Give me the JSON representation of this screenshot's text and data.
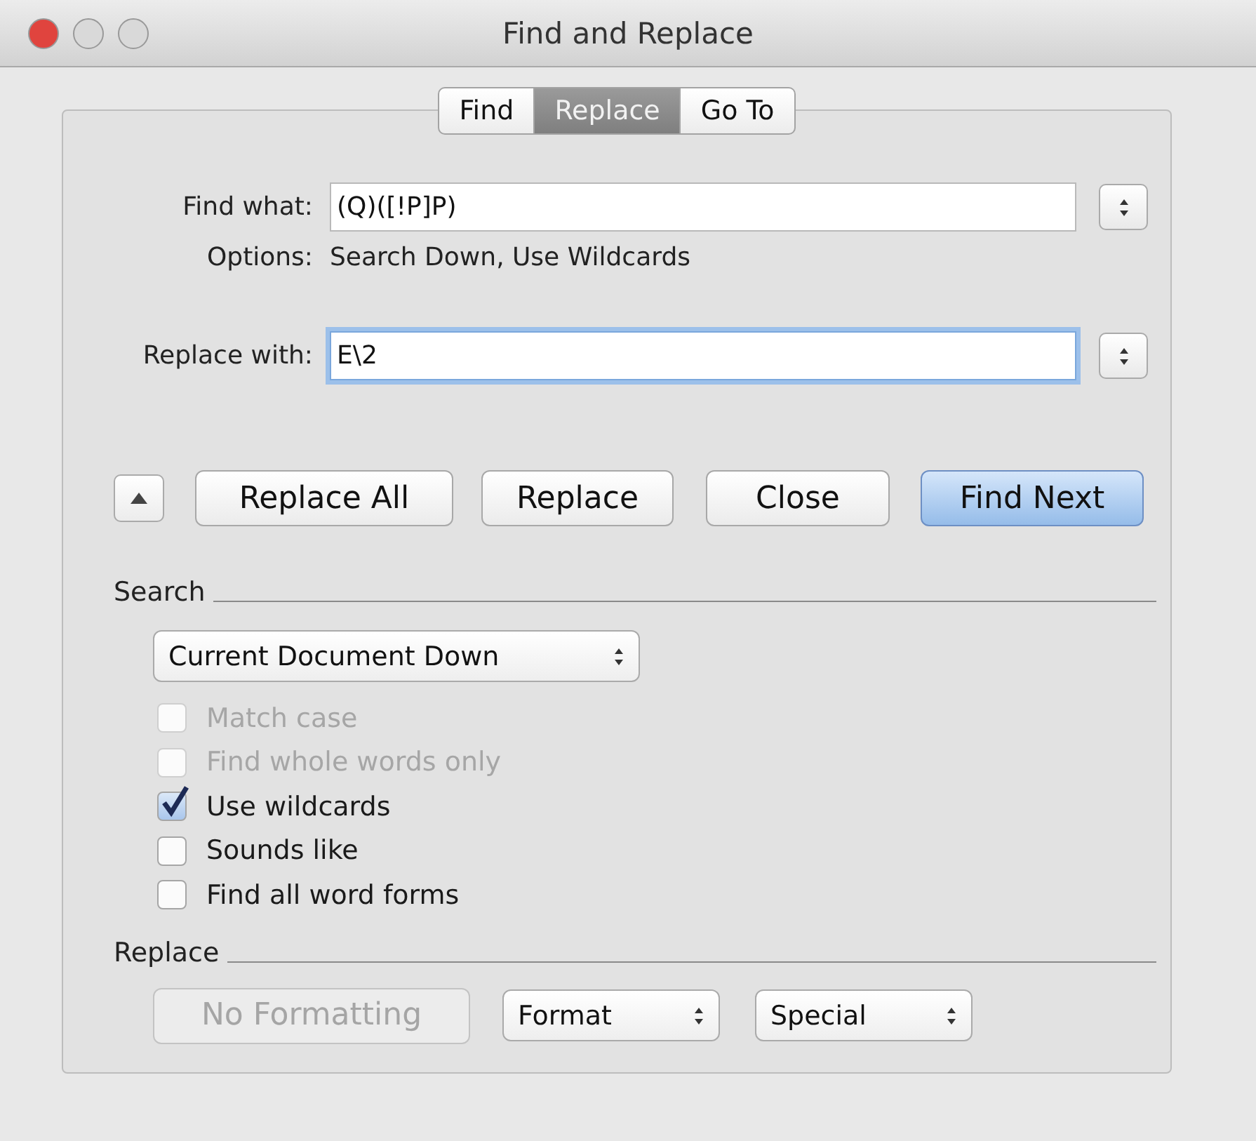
{
  "window": {
    "title": "Find and Replace"
  },
  "tabs": [
    {
      "label": "Find",
      "selected": false
    },
    {
      "label": "Replace",
      "selected": true
    },
    {
      "label": "Go To",
      "selected": false
    }
  ],
  "fields": [
    {
      "label": "Find what:",
      "value": "(Q)([!P]P)",
      "focused": false
    },
    {
      "label": "Replace with:",
      "value": "E\\2",
      "focused": true
    }
  ],
  "options": {
    "label": "Options:",
    "value": "Search Down, Use Wildcards"
  },
  "buttons": [
    {
      "label": "Replace All",
      "default": false
    },
    {
      "label": "Replace",
      "default": false
    },
    {
      "label": "Close",
      "default": false
    },
    {
      "label": "Find Next",
      "default": true
    }
  ],
  "search": {
    "heading": "Search",
    "scope": "Current Document Down",
    "checkboxes": [
      {
        "label": "Match case",
        "checked": false,
        "disabled": true
      },
      {
        "label": "Find whole words only",
        "checked": false,
        "disabled": true
      },
      {
        "label": "Use wildcards",
        "checked": true,
        "disabled": false
      },
      {
        "label": "Sounds like",
        "checked": false,
        "disabled": false
      },
      {
        "label": "Find all word forms",
        "checked": false,
        "disabled": false
      }
    ]
  },
  "replace": {
    "heading": "Replace",
    "no_formatting": {
      "label": "No Formatting",
      "disabled": true
    },
    "popups": [
      "Format",
      "Special"
    ]
  }
}
